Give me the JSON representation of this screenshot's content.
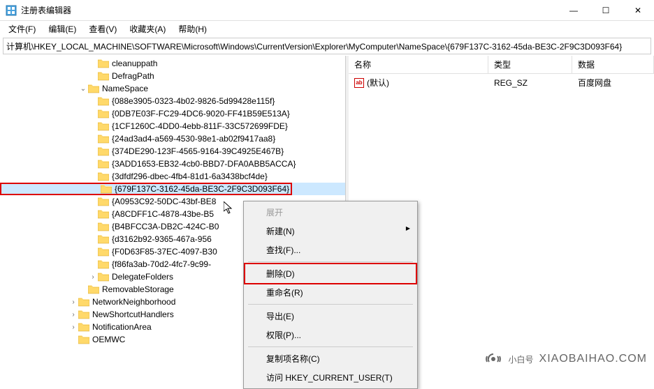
{
  "window": {
    "title": "注册表编辑器",
    "controls": {
      "min": "—",
      "max": "☐",
      "close": "✕"
    }
  },
  "menubar": [
    {
      "label": "文件(F)"
    },
    {
      "label": "编辑(E)"
    },
    {
      "label": "查看(V)"
    },
    {
      "label": "收藏夹(A)"
    },
    {
      "label": "帮助(H)"
    }
  ],
  "address": "计算机\\HKEY_LOCAL_MACHINE\\SOFTWARE\\Microsoft\\Windows\\CurrentVersion\\Explorer\\MyComputer\\NameSpace\\{679F137C-3162-45da-BE3C-2F9C3D093F64}",
  "tree": [
    {
      "indent": 9,
      "toggle": "",
      "label": "cleanuppath"
    },
    {
      "indent": 9,
      "toggle": "",
      "label": "DefragPath"
    },
    {
      "indent": 8,
      "toggle": "v",
      "label": "NameSpace"
    },
    {
      "indent": 9,
      "toggle": "",
      "label": "{088e3905-0323-4b02-9826-5d99428e115f}"
    },
    {
      "indent": 9,
      "toggle": "",
      "label": "{0DB7E03F-FC29-4DC6-9020-FF41B59E513A}"
    },
    {
      "indent": 9,
      "toggle": "",
      "label": "{1CF1260C-4DD0-4ebb-811F-33C572699FDE}"
    },
    {
      "indent": 9,
      "toggle": "",
      "label": "{24ad3ad4-a569-4530-98e1-ab02f9417aa8}"
    },
    {
      "indent": 9,
      "toggle": "",
      "label": "{374DE290-123F-4565-9164-39C4925E467B}"
    },
    {
      "indent": 9,
      "toggle": "",
      "label": "{3ADD1653-EB32-4cb0-BBD7-DFA0ABB5ACCA}"
    },
    {
      "indent": 9,
      "toggle": "",
      "label": "{3dfdf296-dbec-4fb4-81d1-6a3438bcf4de}"
    },
    {
      "indent": 9,
      "toggle": "",
      "label": "{679F137C-3162-45da-BE3C-2F9C3D093F64}",
      "selected": true,
      "redbox": true
    },
    {
      "indent": 9,
      "toggle": "",
      "label": "{A0953C92-50DC-43bf-BE8"
    },
    {
      "indent": 9,
      "toggle": "",
      "label": "{A8CDFF1C-4878-43be-B5"
    },
    {
      "indent": 9,
      "toggle": "",
      "label": "{B4BFCC3A-DB2C-424C-B0"
    },
    {
      "indent": 9,
      "toggle": "",
      "label": "{d3162b92-9365-467a-956"
    },
    {
      "indent": 9,
      "toggle": "",
      "label": "{F0D63F85-37EC-4097-B30"
    },
    {
      "indent": 9,
      "toggle": "",
      "label": "{f86fa3ab-70d2-4fc7-9c99-"
    },
    {
      "indent": 9,
      "toggle": ">",
      "label": "DelegateFolders"
    },
    {
      "indent": 8,
      "toggle": "",
      "label": "RemovableStorage"
    },
    {
      "indent": 7,
      "toggle": ">",
      "label": "NetworkNeighborhood"
    },
    {
      "indent": 7,
      "toggle": ">",
      "label": "NewShortcutHandlers"
    },
    {
      "indent": 7,
      "toggle": ">",
      "label": "NotificationArea"
    },
    {
      "indent": 7,
      "toggle": "",
      "label": "OEMWC"
    }
  ],
  "list": {
    "headers": {
      "name": "名称",
      "type": "类型",
      "data": "数据"
    },
    "rows": [
      {
        "icon": "ab",
        "name": "(默认)",
        "type": "REG_SZ",
        "data": "百度网盘"
      }
    ]
  },
  "context_menu": {
    "items": [
      {
        "label": "展开",
        "disabled": true
      },
      {
        "label": "新建(N)",
        "sub": true
      },
      {
        "label": "查找(F)..."
      },
      {
        "sep": true
      },
      {
        "label": "删除(D)",
        "highlighted": true
      },
      {
        "label": "重命名(R)"
      },
      {
        "sep": true
      },
      {
        "label": "导出(E)"
      },
      {
        "label": "权限(P)..."
      },
      {
        "sep": true
      },
      {
        "label": "复制项名称(C)"
      },
      {
        "label": "访问 HKEY_CURRENT_USER(T)"
      }
    ]
  },
  "watermark": {
    "text": "小白号",
    "url": "XIAOBAIHAO.COM"
  }
}
